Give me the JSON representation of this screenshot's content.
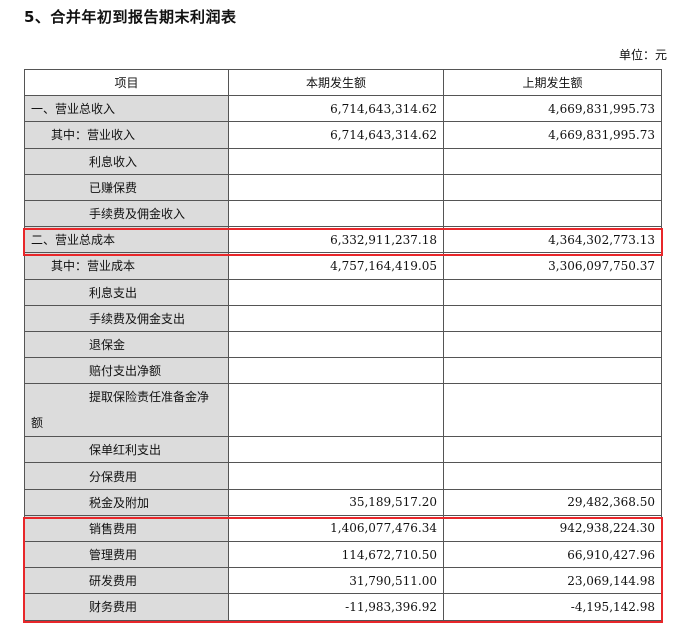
{
  "title": "5、合并年初到报告期末利润表",
  "unit": "单位：元",
  "columns": [
    "项目",
    "本期发生额",
    "上期发生额"
  ],
  "rows": [
    {
      "label": "一、营业总收入",
      "current": "6,714,643,314.62",
      "previous": "4,669,831,995.73"
    },
    {
      "label": "其中：营业收入",
      "current": "6,714,643,314.62",
      "previous": "4,669,831,995.73"
    },
    {
      "label": "利息收入",
      "current": "",
      "previous": ""
    },
    {
      "label": "已赚保费",
      "current": "",
      "previous": ""
    },
    {
      "label": "手续费及佣金收入",
      "current": "",
      "previous": ""
    },
    {
      "label": "二、营业总成本",
      "current": "6,332,911,237.18",
      "previous": "4,364,302,773.13"
    },
    {
      "label": "其中：营业成本",
      "current": "4,757,164,419.05",
      "previous": "3,306,097,750.37"
    },
    {
      "label": "利息支出",
      "current": "",
      "previous": ""
    },
    {
      "label": "手续费及佣金支出",
      "current": "",
      "previous": ""
    },
    {
      "label": "退保金",
      "current": "",
      "previous": ""
    },
    {
      "label": "赔付支出净额",
      "current": "",
      "previous": ""
    },
    {
      "label_line1": "提取保险责任准备金净",
      "label_line2": "额",
      "current": "",
      "previous": ""
    },
    {
      "label": "保单红利支出",
      "current": "",
      "previous": ""
    },
    {
      "label": "分保费用",
      "current": "",
      "previous": ""
    },
    {
      "label": "税金及附加",
      "current": "35,189,517.20",
      "previous": "29,482,368.50"
    },
    {
      "label": "销售费用",
      "current": "1,406,077,476.34",
      "previous": "942,938,224.30"
    },
    {
      "label": "管理费用",
      "current": "114,672,710.50",
      "previous": "66,910,427.96"
    },
    {
      "label": "研发费用",
      "current": "31,790,511.00",
      "previous": "23,069,144.98"
    },
    {
      "label": "财务费用",
      "current": "-11,983,396.92",
      "previous": "-4,195,142.98"
    }
  ],
  "highlight_color": "#e8272a"
}
